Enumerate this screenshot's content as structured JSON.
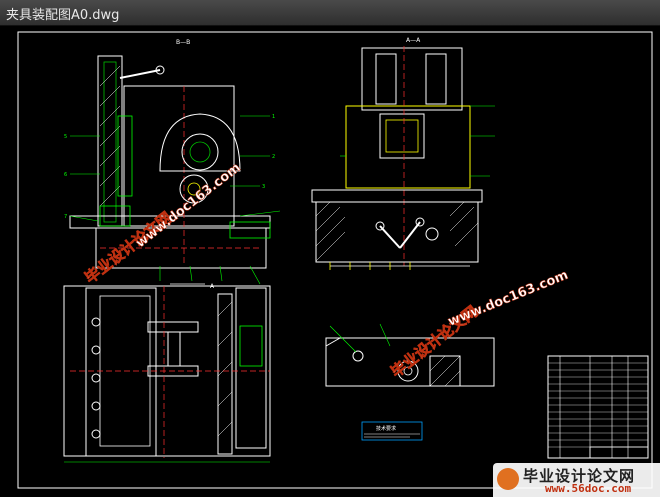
{
  "window": {
    "title": "夹具装配图A0.dwg"
  },
  "drawing": {
    "section_label_left": "B—B",
    "section_label_right": "A—A",
    "view_label_bottom": "A",
    "notes_header": "技术要求",
    "title_block_caption": ""
  },
  "watermarks": {
    "site_cn": "毕业设计论文网",
    "site_url": "www.doc163.com"
  },
  "footer_logo": {
    "name_cn": "毕业设计论文网",
    "url": "www.56doc.com"
  }
}
